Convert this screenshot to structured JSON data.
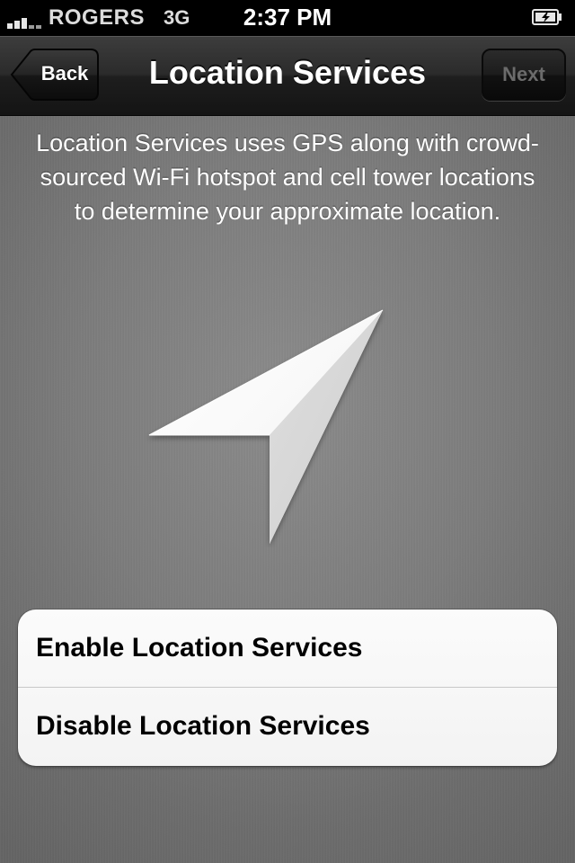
{
  "status_bar": {
    "carrier": "ROGERS",
    "network": "3G",
    "time": "2:37 PM",
    "signal_icon": "signal-bars-icon",
    "battery_icon": "battery-charging-icon"
  },
  "nav_bar": {
    "title": "Location Services",
    "back_label": "Back",
    "next_label": "Next"
  },
  "content": {
    "description": "Location Services uses GPS along with crowd-sourced Wi-Fi hotspot and cell tower locations to determine your approximate location.",
    "hero_icon": "location-arrow-icon"
  },
  "options": [
    {
      "label": "Enable Location Services"
    },
    {
      "label": "Disable Location Services"
    }
  ],
  "colors": {
    "background": "#7c7c7c",
    "nav_bar": "#2b2b2b",
    "text_light": "#ffffff",
    "next_disabled_text": "#6b6b6b",
    "list_background": "#f7f7f7"
  }
}
